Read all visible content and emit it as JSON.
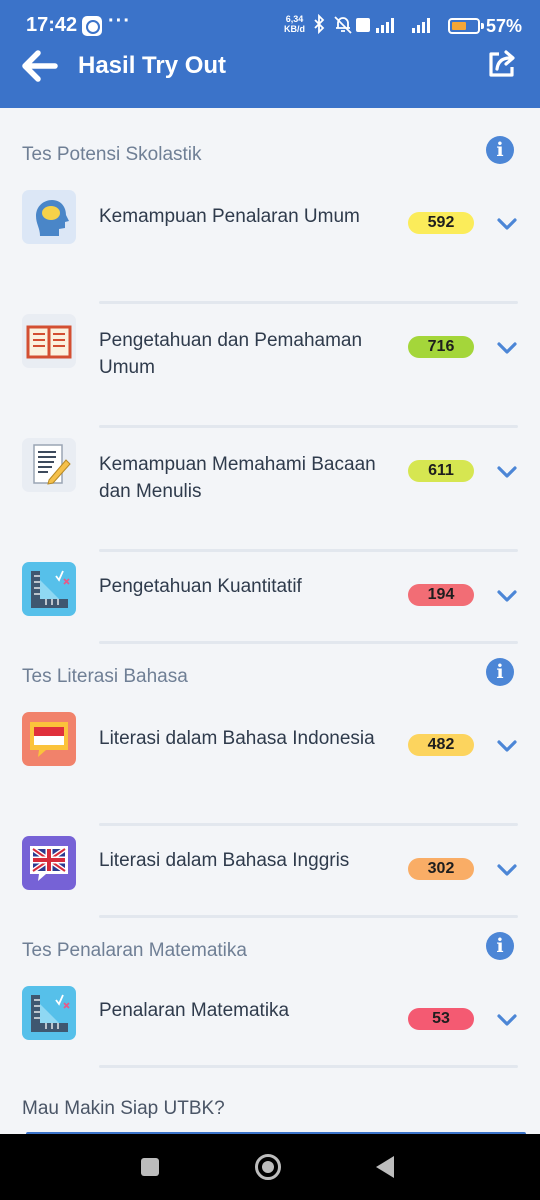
{
  "status_bar": {
    "time": "17:42",
    "speed_value": "6,34",
    "speed_unit": "KB/d",
    "battery": "57%",
    "battery_level": 0.57
  },
  "header": {
    "title": "Hasil Try Out"
  },
  "sections": [
    {
      "title": "Tes Potensi Skolastik",
      "items": [
        {
          "label": "Kemampuan Penalaran Umum",
          "score": "592",
          "color": "#fbec5a",
          "icon": "head-thinking-icon"
        },
        {
          "label": "Pengetahuan dan Pemahaman Umum",
          "score": "716",
          "color": "#a4d63a",
          "icon": "open-book-icon"
        },
        {
          "label": "Kemampuan Memahami Bacaan dan Menulis",
          "score": "611",
          "color": "#d6e651",
          "icon": "document-pencil-icon"
        },
        {
          "label": "Pengetahuan Kuantitatif",
          "score": "194",
          "color": "#f26d75",
          "icon": "ruler-math-icon"
        }
      ]
    },
    {
      "title": "Tes Literasi Bahasa",
      "items": [
        {
          "label": "Literasi dalam Bahasa Indonesia",
          "score": "482",
          "color": "#fcd45e",
          "icon": "indonesia-flag-chat-icon"
        },
        {
          "label": "Literasi dalam Bahasa Inggris",
          "score": "302",
          "color": "#f9ad66",
          "icon": "uk-flag-chat-icon"
        }
      ]
    },
    {
      "title": "Tes Penalaran Matematika",
      "items": [
        {
          "label": "Penalaran Matematika",
          "score": "53",
          "color": "#f45a72",
          "icon": "ruler-math-icon"
        }
      ]
    }
  ],
  "footer": {
    "prompt": "Mau Makin Siap UTBK?"
  },
  "colors": {
    "primary": "#3b73c9",
    "background": "#f3f5f8"
  }
}
